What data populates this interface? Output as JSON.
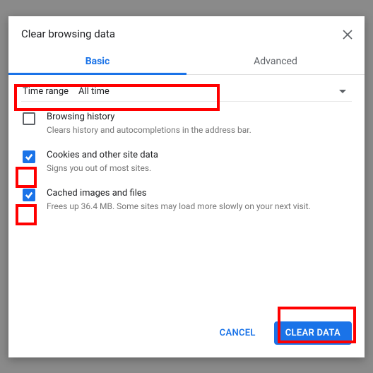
{
  "dialog": {
    "title": "Clear browsing data",
    "tabs": {
      "basic": "Basic",
      "advanced": "Advanced"
    },
    "timerange": {
      "label": "Time range",
      "value": "All time"
    },
    "items": [
      {
        "title": "Browsing history",
        "desc": "Clears history and autocompletions in the address bar.",
        "checked": false
      },
      {
        "title": "Cookies and other site data",
        "desc": "Signs you out of most sites.",
        "checked": true
      },
      {
        "title": "Cached images and files",
        "desc": "Frees up 36.4 MB. Some sites may load more slowly on your next visit.",
        "checked": true
      }
    ],
    "buttons": {
      "cancel": "CANCEL",
      "clear": "CLEAR DATA"
    }
  }
}
